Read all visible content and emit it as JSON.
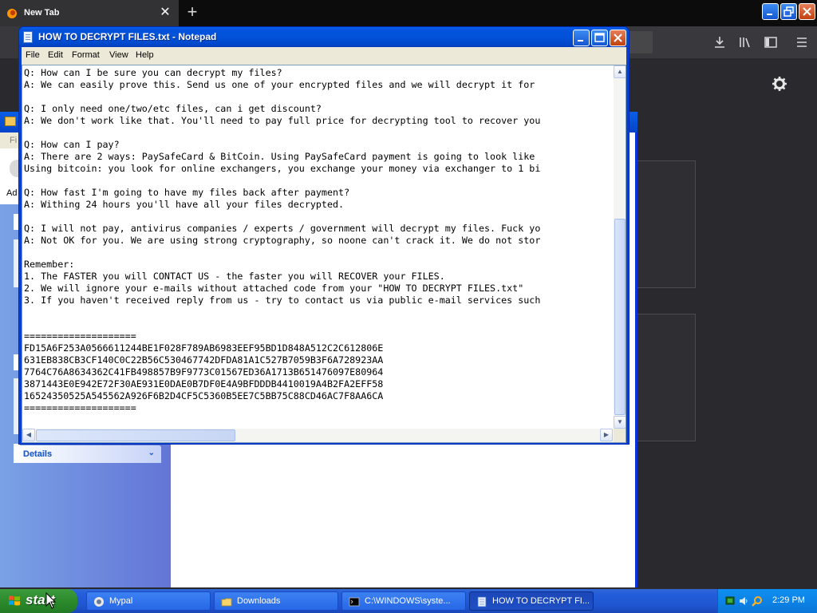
{
  "firefox": {
    "tab_title": "New Tab",
    "tab_close": "✕",
    "new_tab": "+"
  },
  "explorer": {
    "menu_first_letter": "Fi",
    "address_prefix": "Ad",
    "details_label": "Details"
  },
  "notepad": {
    "title": "HOW TO DECRYPT FILES.txt - Notepad",
    "menu": [
      "File",
      "Edit",
      "Format",
      "View",
      "Help"
    ],
    "lines": [
      "Q: How can I be sure you can decrypt my files?",
      "A: We can easily prove this. Send us one of your encrypted files and we will decrypt it for",
      "",
      "Q: I only need one/two/etc files, can i get discount?",
      "A: We don't work like that. You'll need to pay full price for decrypting tool to recover you",
      "",
      "Q: How can I pay?",
      "A: There are 2 ways: PaySafeCard & BitCoin. Using PaySafeCard payment is going to look like",
      "Using bitcoin: you look for online exchangers, you exchange your money via exchanger to 1 bi",
      "",
      "Q: How fast I'm going to have my files back after payment?",
      "A: Withing 24 hours you'll have all your files decrypted.",
      "",
      "Q: I will not pay, antivirus companies / experts / government will decrypt my files. Fuck yo",
      "A: Not OK for you. We are using strong cryptography, so noone can't crack it. We do not stor",
      "",
      "Remember:",
      "1. The FASTER you will CONTACT US - the faster you will RECOVER your FILES.",
      "2. We will ignore your e-mails without attached code from your \"HOW TO DECRYPT FILES.txt\"",
      "3. If you haven't received reply from us - try to contact us via public e-mail services such",
      "",
      "",
      "====================",
      "FD15A6F253A0566611244BE1F028F789AB6983EEF95BD1D848A512C2C612806E",
      "631EB838CB3CF140C0C22B56C530467742DFDA81A1C527B7059B3F6A728923AA",
      "7764C76A8634362C41FB498857B9F9773C01567ED36A1713B651476097E80964",
      "3871443E0E942E72F30AE931E0DAE0B7DF0E4A9BFDDDB4410019A4B2FA2EFF58",
      "16524350525A545562A926F6B2D4CF5C5360B5EE7C5BB75C88CD46AC7F8AA6CA",
      "===================="
    ]
  },
  "taskbar": {
    "start_label": "start",
    "buttons": [
      {
        "label": "Mypal",
        "icon": "mypal-icon"
      },
      {
        "label": "Downloads",
        "icon": "folder-icon"
      },
      {
        "label": "C:\\WINDOWS\\syste...",
        "icon": "cmd-icon"
      },
      {
        "label": "HOW TO DECRYPT FI...",
        "icon": "notepad-icon"
      }
    ],
    "clock": "2:29 PM"
  }
}
